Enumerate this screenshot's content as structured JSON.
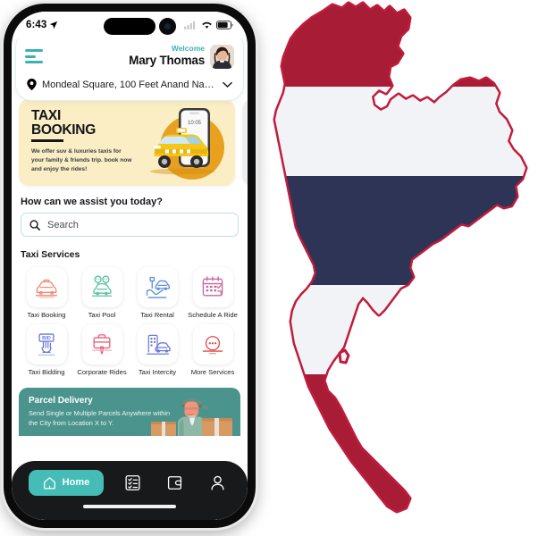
{
  "statusbar": {
    "time": "6:43",
    "location_arrow_icon": "location-arrow-icon",
    "signal_icon": "cellular-signal-icon",
    "wifi_icon": "wifi-icon",
    "battery_icon": "battery-icon"
  },
  "header": {
    "menu_icon": "hamburger-menu-icon",
    "welcome_label": "Welcome",
    "user_name": "Mary Thomas",
    "avatar_icon": "user-avatar",
    "location_pin_icon": "map-pin-icon",
    "location_text": "Mondeal Square, 100 Feet Anand Naga...",
    "chevron_icon": "chevron-down-icon"
  },
  "banner": {
    "title_line1": "TAXI",
    "title_line2": "BOOKING",
    "subtitle": "We offer suv & luxuries taxis for your family & friends trip. book now and enjoy the rides!",
    "art_icon": "taxi-phone-illustration",
    "bg_color": "#fbeec4"
  },
  "assist": {
    "heading": "How can we assist you today?",
    "search_icon": "search-icon",
    "search_placeholder": "Search",
    "search_value": ""
  },
  "services": {
    "heading": "Taxi Services",
    "items": [
      {
        "label": "Taxi Booking",
        "icon": "taxi-car-icon",
        "color": "#f08a72"
      },
      {
        "label": "Taxi Pool",
        "icon": "taxi-pool-icon",
        "color": "#5cc2a3"
      },
      {
        "label": "Taxi Rental",
        "icon": "taxi-rental-icon",
        "color": "#5b8fd8"
      },
      {
        "label": "Schedule A Ride",
        "icon": "calendar-icon",
        "color": "#c766a0"
      },
      {
        "label": "Taxi Bidding",
        "icon": "bid-hand-icon",
        "color": "#6b79d8"
      },
      {
        "label": "Corporate Rides",
        "icon": "briefcase-tie-icon",
        "color": "#e8607a"
      },
      {
        "label": "Taxi Intercity",
        "icon": "city-car-icon",
        "color": "#6b79d8"
      },
      {
        "label": "More Services",
        "icon": "more-dots-icon",
        "color": "#e04a4a"
      }
    ]
  },
  "parcel": {
    "title": "Parcel Delivery",
    "subtitle": "Send Single or Multiple Parcels Anywhere within the City from Location X to Y.",
    "art_icon": "delivery-person-illustration",
    "bg_color": "#4a948d"
  },
  "bottom_nav": {
    "items": [
      {
        "label": "Home",
        "icon": "home-icon",
        "active": true
      },
      {
        "label": "",
        "icon": "list-icon",
        "active": false
      },
      {
        "label": "",
        "icon": "wallet-icon",
        "active": false
      },
      {
        "label": "",
        "icon": "profile-icon",
        "active": false
      }
    ],
    "active_color": "#45bdb6",
    "bg_color": "#17191a"
  },
  "map": {
    "name": "thailand-flag-map",
    "stripe_red": "#a81c35",
    "stripe_white": "#f2f3f7",
    "stripe_navy": "#2d3456",
    "outline": "#c01c3c"
  }
}
